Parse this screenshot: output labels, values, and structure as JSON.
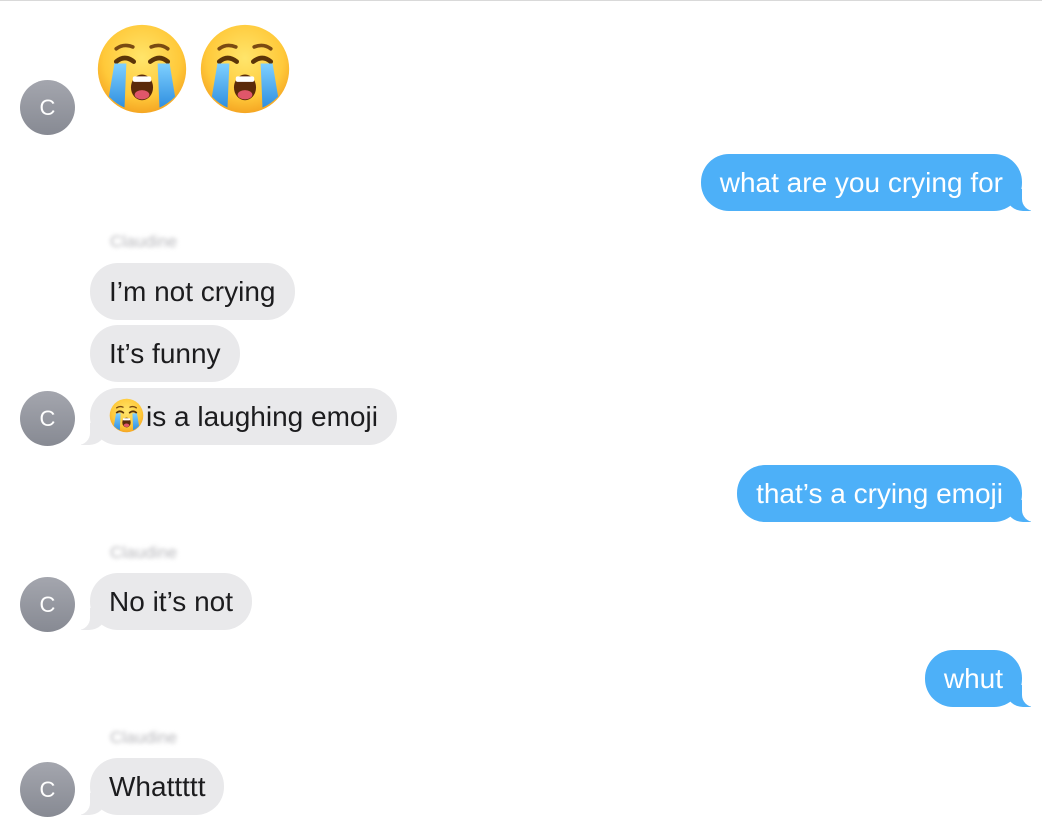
{
  "contact": {
    "initial": "C",
    "sender_name": "Claudine"
  },
  "messages": [
    {
      "from": "contact",
      "type": "emoji",
      "icon": "loudly-crying-face"
    },
    {
      "from": "me",
      "text": "what are you crying for"
    },
    {
      "from": "contact",
      "text": "I’m not crying"
    },
    {
      "from": "contact",
      "text": "It’s funny"
    },
    {
      "from": "contact",
      "text": "is a laughing emoji",
      "icon": "loudly-crying-face"
    },
    {
      "from": "me",
      "text": "that’s a crying emoji"
    },
    {
      "from": "contact",
      "text": "No it’s not"
    },
    {
      "from": "me",
      "text": "whut"
    },
    {
      "from": "contact",
      "text": "Whattttt"
    }
  ],
  "colors": {
    "outgoing_bubble": "#4db0f8",
    "incoming_bubble": "#e9e9eb",
    "avatar": "#8e9199"
  }
}
